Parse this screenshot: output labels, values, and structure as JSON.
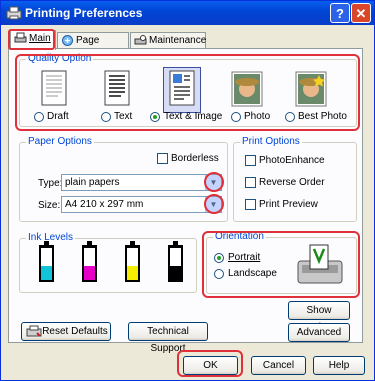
{
  "window": {
    "title": "Printing Preferences"
  },
  "tabs": [
    {
      "label": "Main"
    },
    {
      "label": "Page Layout"
    },
    {
      "label": "Maintenance"
    }
  ],
  "quality": {
    "title": "Quality Option",
    "options": [
      {
        "label": "Draft",
        "selected": false
      },
      {
        "label": "Text",
        "selected": false
      },
      {
        "label": "Text & Image",
        "selected": true
      },
      {
        "label": "Photo",
        "selected": false
      },
      {
        "label": "Best Photo",
        "selected": false
      }
    ]
  },
  "paper": {
    "title": "Paper Options",
    "borderless_label": "Borderless",
    "type_label": "Type:",
    "type_value": "plain papers",
    "size_label": "Size:",
    "size_value": "A4 210 x 297 mm"
  },
  "print_options": {
    "title": "Print Options",
    "items": [
      {
        "label": "PhotoEnhance"
      },
      {
        "label": "Reverse Order"
      },
      {
        "label": "Print Preview"
      }
    ]
  },
  "ink": {
    "title": "Ink Levels",
    "cartridges": [
      {
        "color": "#12c4d8",
        "level": 0.45
      },
      {
        "color": "#e600c8",
        "level": 0.45
      },
      {
        "color": "#f5ee00",
        "level": 0.45
      },
      {
        "color": "#000000",
        "level": 0.45
      }
    ]
  },
  "orientation": {
    "title": "Orientation",
    "portrait": "Portrait",
    "landscape": "Landscape",
    "selected": "portrait"
  },
  "buttons": {
    "show_settings": "Show Settings",
    "advanced": "Advanced",
    "reset_defaults": "Reset Defaults",
    "technical_support": "Technical Support",
    "ok": "OK",
    "cancel": "Cancel",
    "help": "Help"
  },
  "title_buttons": {
    "help": "?",
    "close": "✕"
  },
  "colors": {
    "highlight": "#e0303a",
    "accent": "#0046d5"
  }
}
